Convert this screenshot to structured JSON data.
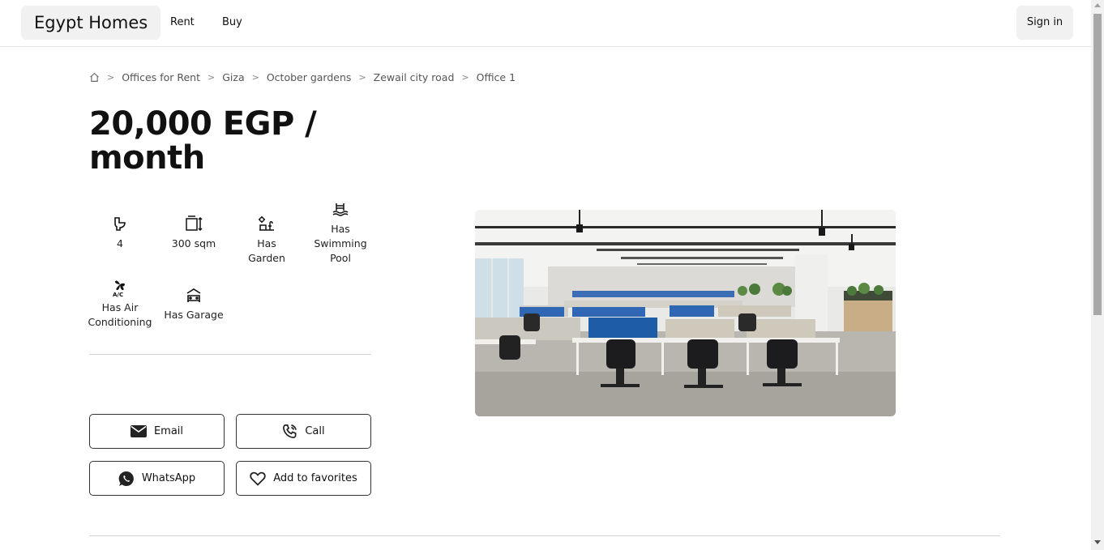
{
  "nav": {
    "brand": "Egypt Homes",
    "links": [
      "Rent",
      "Buy"
    ],
    "signin": "Sign in"
  },
  "breadcrumb": {
    "home_icon": "home-icon",
    "items": [
      "Offices for Rent",
      "Giza",
      "October gardens",
      "Zewail city road",
      "Office 1"
    ]
  },
  "listing": {
    "price": "20,000 EGP / month",
    "features": [
      {
        "icon": "toilet-icon",
        "label": "4"
      },
      {
        "icon": "area-icon",
        "label": "300 sqm"
      },
      {
        "icon": "garden-icon",
        "label": "Has Garden"
      },
      {
        "icon": "pool-icon",
        "label": "Has Swimming Pool"
      },
      {
        "icon": "air-conditioning-icon",
        "label": "Has Air Conditioning"
      },
      {
        "icon": "garage-icon",
        "label": "Has Garage"
      }
    ]
  },
  "actions": {
    "email": "Email",
    "call": "Call",
    "whatsapp": "WhatsApp",
    "favorites": "Add to favorites"
  },
  "colors": {
    "text": "#111111",
    "chip_bg": "#f1f1f1",
    "border": "#333333",
    "divider": "#d4d4d4"
  }
}
